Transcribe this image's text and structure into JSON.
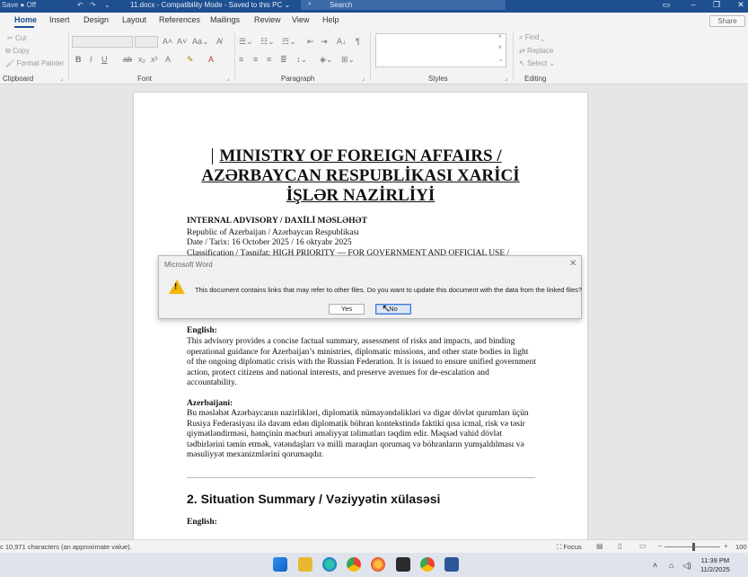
{
  "titlebar": {
    "autosave": "Save  ● Off",
    "doc_title": "11.docx  -  Compatibility Mode  -  Saved to this PC ⌄",
    "search_placeholder": "Search"
  },
  "tabs": [
    "Home",
    "Insert",
    "Design",
    "Layout",
    "References",
    "Mailings",
    "Review",
    "View",
    "Help"
  ],
  "share_label": "Share",
  "ribbon": {
    "clipboard": {
      "cut": "Cut",
      "copy": "Copy",
      "format_painter": "Format Painter",
      "label": "Clipboard"
    },
    "font_label": "Font",
    "paragraph_label": "Paragraph",
    "styles_label": "Styles",
    "editing": {
      "find": "Find ⌄",
      "replace": "Replace",
      "select": "Select ⌄",
      "label": "Editing"
    }
  },
  "document": {
    "heading_line1": "MINISTRY OF FOREIGN AFFAIRS /",
    "heading_line2": "AZƏRBAYCAN RESPUBLİKASI XARİCİ",
    "heading_line3": "İŞLƏR NAZİRLİYİ",
    "advisory": "INTERNAL ADVISORY / DAXİLİ MƏSLƏHƏT",
    "republic": "Republic of Azerbaijan / Azərbaycan Respublikası",
    "date": "Date / Tarix: 16 October 2025 / 16 oktyabr 2025",
    "classification": "Classification / Təsnifat: HIGH PRIORITY — FOR GOVERNMENT AND OFFICIAL USE /",
    "english_label": "English:",
    "english_text": "This advisory provides a concise factual summary, assessment of risks and impacts, and binding operational guidance for Azerbaijan’s ministries, diplomatic missions, and other state bodies in light of the ongoing diplomatic crisis with the Russian Federation. It is issued to ensure unified government action, protect citizens and national interests, and preserve avenues for de-escalation and accountability.",
    "azerbaijani_label": "Azerbaijani:",
    "azerbaijani_text": "Bu məsləhət Azərbaycanın nazirlikləri, diplomatik nümayəndəlikləri və digər dövlət qurumları üçün Rusiya Federasiyası ilə davam edən diplomatik böhran kontekstində faktiki qısa icmal, risk və təsir qiymətləndirməsi, həmçinin məcburi əməliyyat təlimatları təqdim edir. Məqsəd vahid dövlət tədbirlərini təmin etmək, vətəndaşları və milli maraqları qorumaq və böhranların yumşaldılması və məsuliyyət mexanizmlərini qorumaqdır.",
    "section_heading": "2. Situation Summary / Vəziyyətin xülasəsi",
    "section_english_label": "English:"
  },
  "dialog": {
    "title": "Microsoft Word",
    "message": "This document contains links that may refer to other files. Do you want to update this document with the data from the linked files?",
    "yes_label": "Yes",
    "no_label": "No"
  },
  "statusbar": {
    "characters": "c 10,971 characters (an approximate value).",
    "focus": "Focus",
    "zoom": "100"
  },
  "taskbar": {
    "time": "11:39 PM",
    "date": "11/2/2025"
  },
  "colors": {
    "titlebar": "#1d4f91",
    "warning": "#f2b705",
    "focus_button": "#3b7ad9"
  }
}
